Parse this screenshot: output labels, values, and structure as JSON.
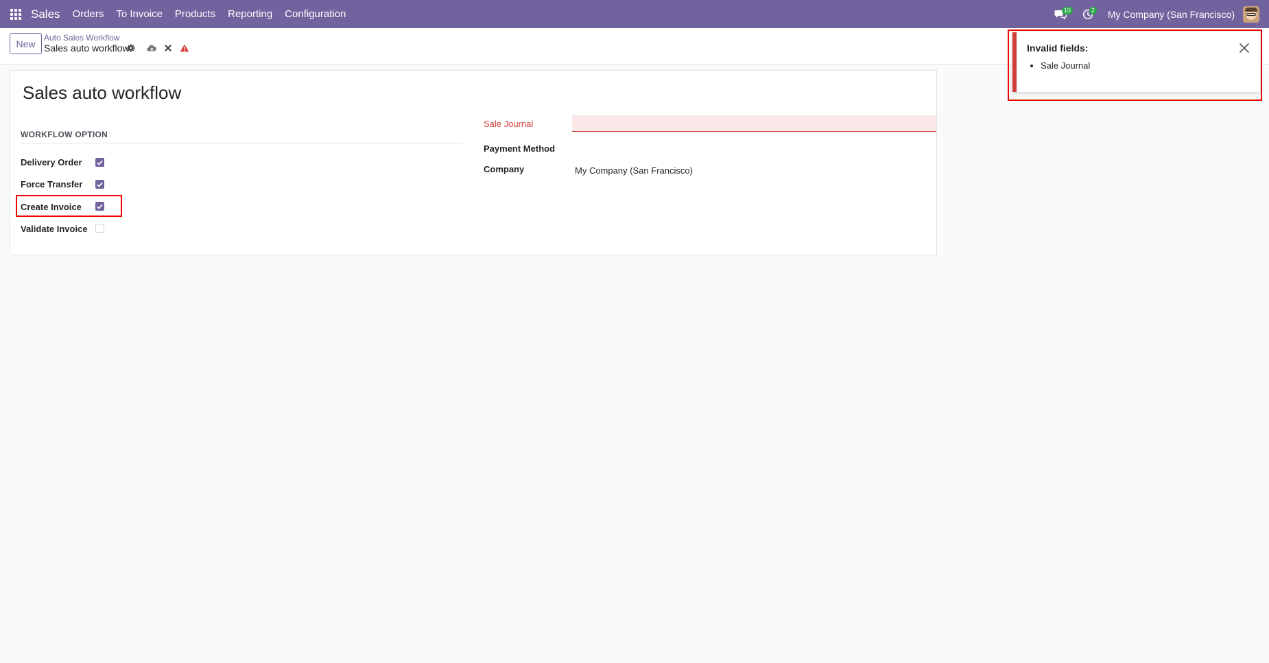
{
  "navbar": {
    "app_name": "Sales",
    "menu": [
      "Orders",
      "To Invoice",
      "Products",
      "Reporting",
      "Configuration"
    ],
    "messages_count": "10",
    "activities_count": "2",
    "company": "My Company (San Francisco)"
  },
  "control_panel": {
    "new_label": "New",
    "breadcrumb_parent": "Auto Sales Workflow",
    "breadcrumb_current": "Sales auto workflow"
  },
  "form": {
    "title": "Sales auto workflow",
    "group_title": "WORKFLOW OPTION",
    "options": [
      {
        "label": "Delivery Order",
        "checked": true
      },
      {
        "label": "Force Transfer",
        "checked": true
      },
      {
        "label": "Create Invoice",
        "checked": true
      },
      {
        "label": "Validate Invoice",
        "checked": false
      }
    ],
    "sale_journal_label": "Sale Journal",
    "sale_journal_value": "",
    "payment_method_label": "Payment Method",
    "payment_method_value": "",
    "company_label": "Company",
    "company_value": "My Company (San Francisco)"
  },
  "notification": {
    "title": "Invalid fields:",
    "items": [
      "Sale Journal"
    ]
  },
  "colors": {
    "brand": "#71639e",
    "danger": "#d23f3a",
    "highlight": "#e00000"
  }
}
